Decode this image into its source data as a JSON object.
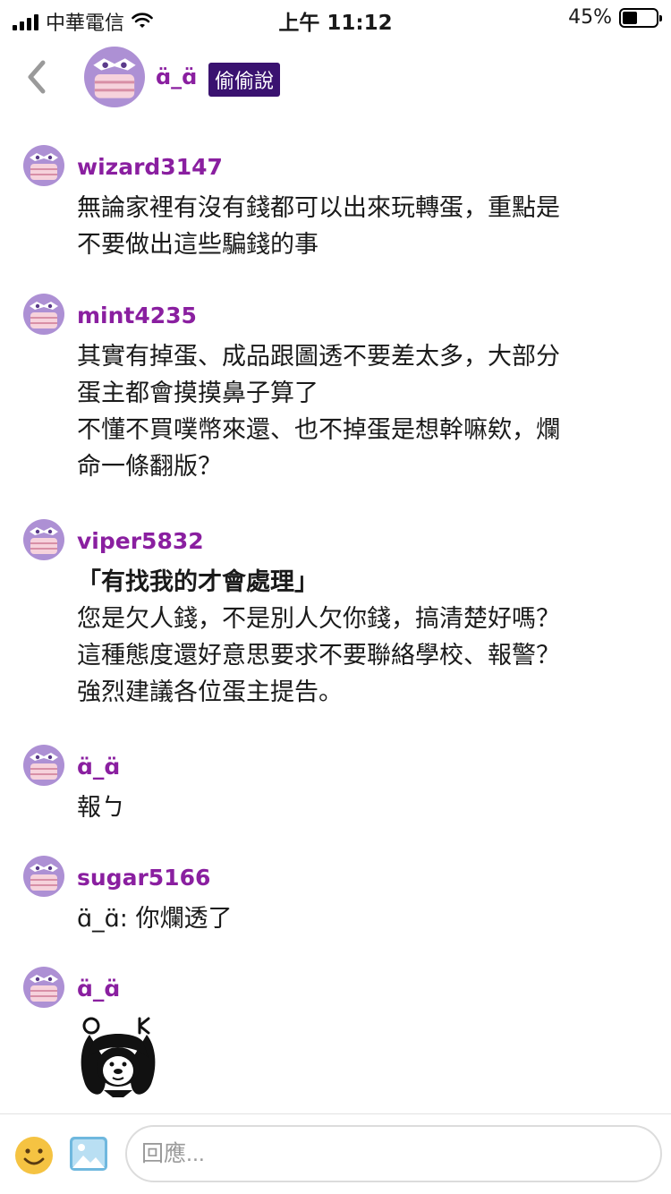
{
  "status_bar": {
    "carrier": "中華電信",
    "time": "上午 11:12",
    "battery": "45%",
    "battery_level": 0.45
  },
  "header": {
    "op_name": "ɑ̈_ɑ̈",
    "tag": "偷偷說"
  },
  "comments": [
    {
      "username": "wizard3147",
      "lines": [
        "無論家裡有沒有錢都可以出來玩轉蛋，重點是",
        "不要做出這些騙錢的事"
      ]
    },
    {
      "username": "mint4235",
      "lines": [
        "其實有掉蛋、成品跟圖透不要差太多，大部分",
        "蛋主都會摸摸鼻子算了",
        "不懂不買噗幣來還、也不掉蛋是想幹嘛欸，爛",
        "命一條翻版？"
      ]
    },
    {
      "username": "viper5832",
      "lines": [
        "「有找我的才會處理」",
        "您是欠人錢，不是別人欠你錢，搞清楚好嗎？",
        "這種態度還好意思要求不要聯絡學校、報警？",
        "強烈建議各位蛋主提告。"
      ]
    },
    {
      "username": "ɑ̈_ɑ̈",
      "lines": [
        "報ㄅ"
      ]
    },
    {
      "username": "sugar5166",
      "lines": [
        "ɑ̈_ɑ̈: 你爛透了"
      ]
    },
    {
      "username": "ɑ̈_ɑ̈",
      "sticker_text": "O K"
    }
  ],
  "reply": {
    "placeholder": "回應..."
  },
  "colors": {
    "username": "#8a1fa0",
    "tag_bg": "#3a1270",
    "avatar": "#a98bd0"
  },
  "icons": {
    "back": "chevron-left-icon",
    "emoji": "smiley-icon",
    "image": "image-icon",
    "wifi": "wifi-icon",
    "signal": "signal-icon",
    "battery": "battery-icon"
  }
}
